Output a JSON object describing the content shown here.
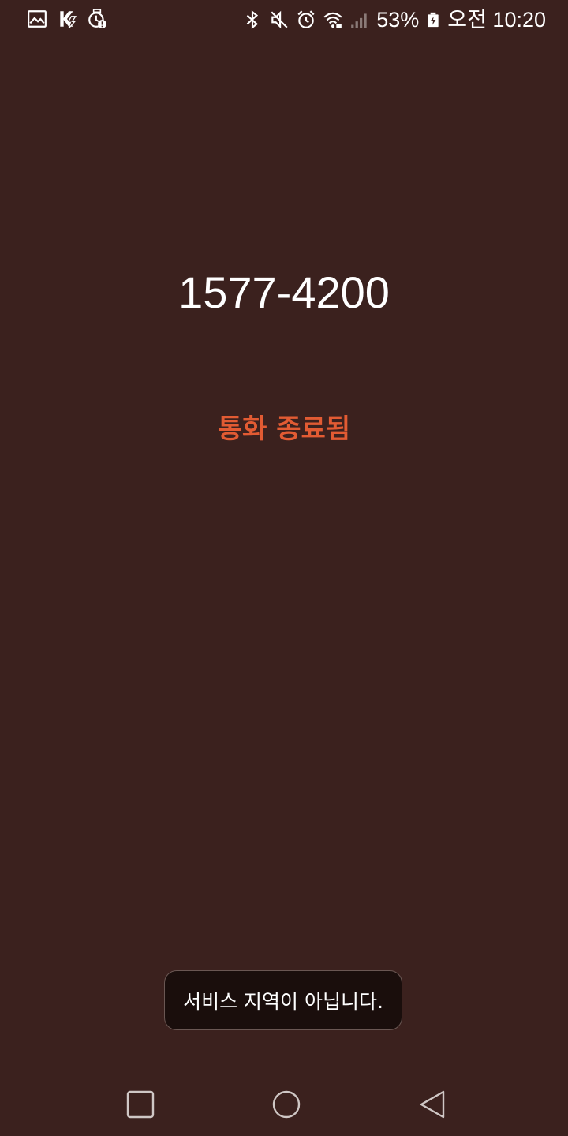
{
  "status_bar": {
    "left_icons": [
      "gallery-icon",
      "k-app-icon",
      "watch-alert-icon"
    ],
    "right_icons": [
      "bluetooth-icon",
      "mute-icon",
      "alarm-icon",
      "wifi-icon",
      "signal-icon"
    ],
    "battery_percent": "53%",
    "time": "오전 10:20"
  },
  "call": {
    "number": "1577-4200",
    "status": "통화 종료됨",
    "status_color": "#e25b33"
  },
  "toast": {
    "message": "서비스 지역이 아닙니다."
  },
  "nav_bar": {
    "buttons": [
      "recents-icon",
      "home-icon",
      "back-icon"
    ]
  },
  "colors": {
    "background": "#3b211e",
    "toast_background": "#1a0e0c"
  }
}
